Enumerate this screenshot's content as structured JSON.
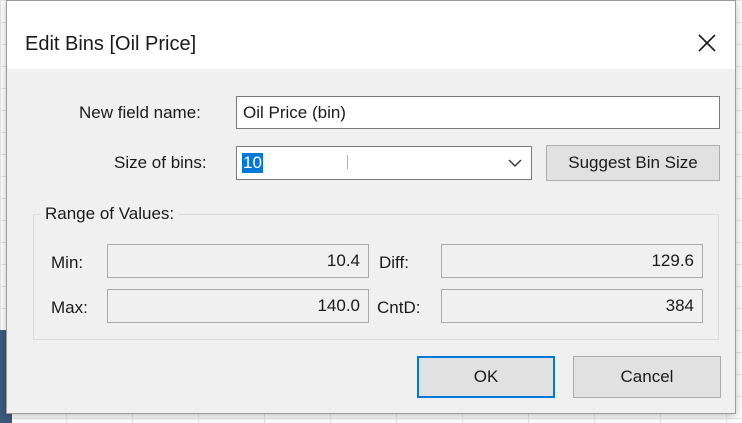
{
  "dialog": {
    "title": "Edit Bins [Oil Price]",
    "close_icon": "close-icon"
  },
  "fields": {
    "new_field_name_label": "New field name:",
    "new_field_name_value": "Oil Price (bin)",
    "size_of_bins_label": "Size of bins:",
    "size_of_bins_value": "10",
    "suggest_button_label": "Suggest Bin Size"
  },
  "range": {
    "title": "Range of Values:",
    "min_label": "Min:",
    "min_value": "10.4",
    "max_label": "Max:",
    "max_value": "140.0",
    "diff_label": "Diff:",
    "diff_value": "129.6",
    "cntd_label": "CntD:",
    "cntd_value": "384"
  },
  "buttons": {
    "ok_label": "OK",
    "cancel_label": "Cancel"
  },
  "colors": {
    "selection": "#0078d7",
    "dialog_bg": "#f0f0f0"
  }
}
